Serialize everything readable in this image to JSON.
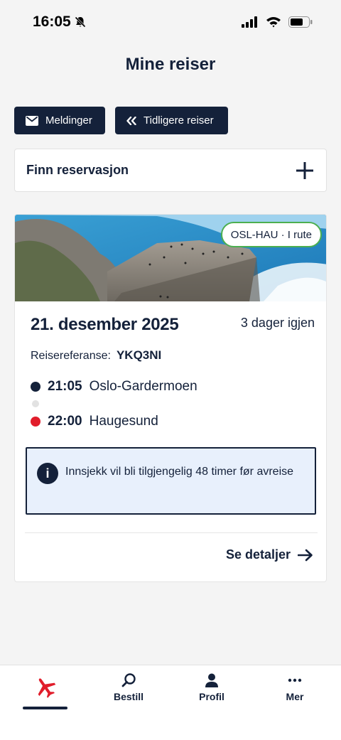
{
  "status_bar": {
    "time": "16:05",
    "icons": [
      "bell-slash-icon",
      "signal-icon",
      "wifi-icon",
      "battery-icon"
    ]
  },
  "header": {
    "title": "Mine reiser"
  },
  "actions": {
    "messages_label": "Meldinger",
    "previous_trips_label": "Tidligere reiser"
  },
  "find_reservation": {
    "label": "Finn reservasjon"
  },
  "trip": {
    "route_badge": "OSL-HAU · I rute",
    "date": "21. desember 2025",
    "days_left": "3 dager igjen",
    "reference_label": "Reisereferanse:",
    "reference_value": "YKQ3NI",
    "departure": {
      "time": "21:05",
      "place": "Oslo-Gardermoen"
    },
    "arrival": {
      "time": "22:00",
      "place": "Haugesund"
    },
    "info": "Innsjekk vil bli tilgjengelig 48 timer før avreise",
    "details_label": "Se detaljer"
  },
  "tab_bar": {
    "items": [
      {
        "label": "",
        "icon": "plane-icon",
        "active": true
      },
      {
        "label": "Bestill",
        "icon": "search-icon"
      },
      {
        "label": "Profil",
        "icon": "user-icon"
      },
      {
        "label": "Mer",
        "icon": "more-icon"
      }
    ]
  },
  "colors": {
    "navy": "#14213a",
    "red": "#e11d2b",
    "info_bg": "#e8f0fc",
    "badge_border": "#4caf50"
  }
}
